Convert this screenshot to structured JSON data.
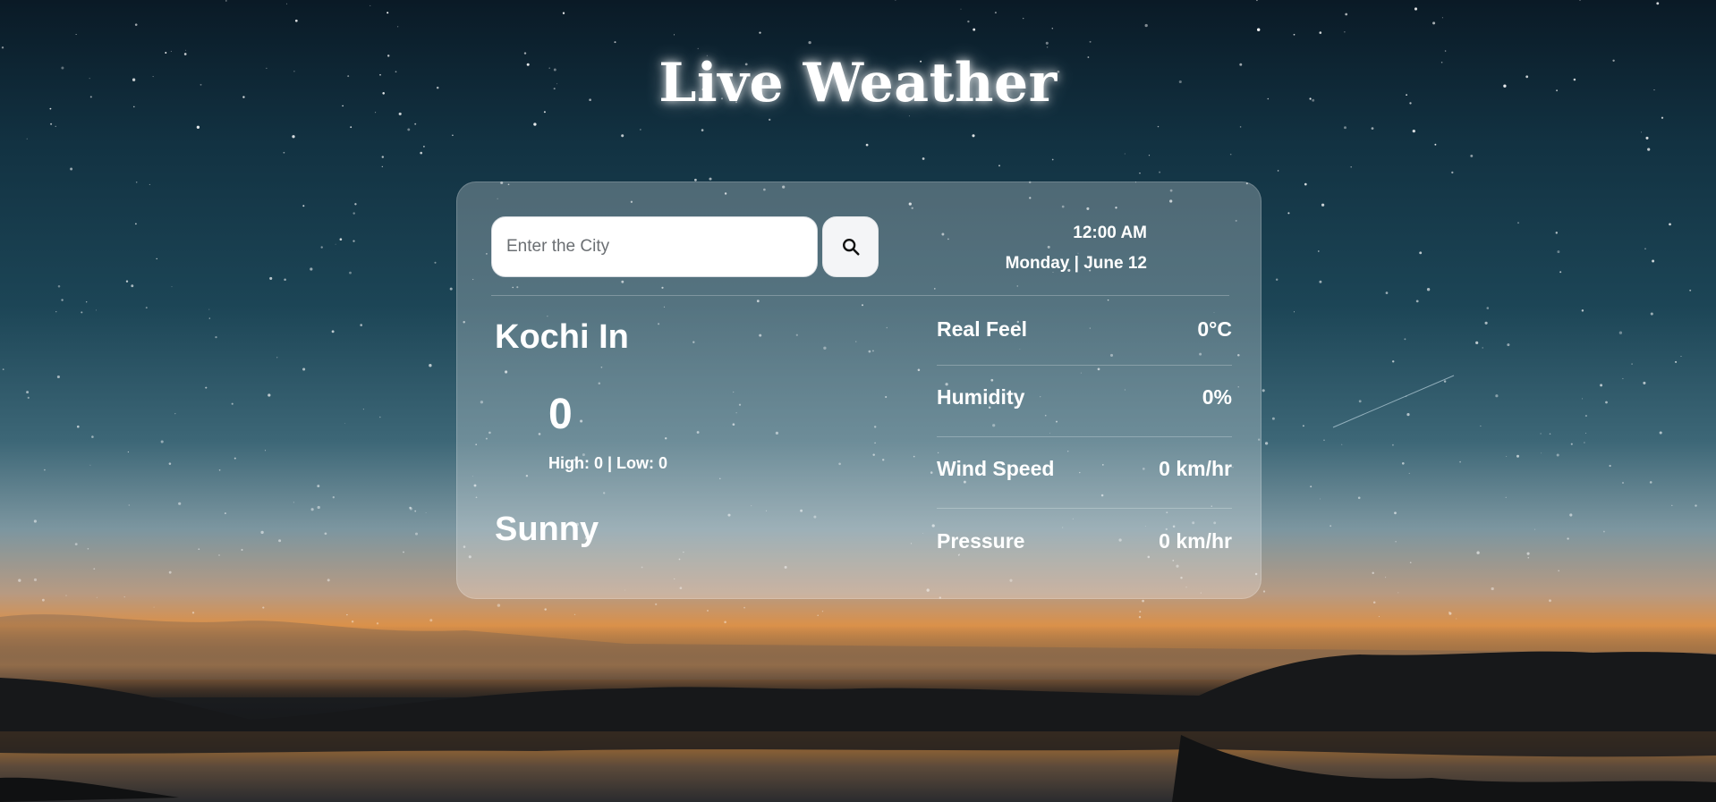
{
  "app": {
    "title": "Live Weather"
  },
  "search": {
    "placeholder": "Enter the City",
    "value": ""
  },
  "datetime": {
    "time": "12:00 AM",
    "date": "Monday | June 12"
  },
  "weather": {
    "city": "Kochi In",
    "temperature": "0",
    "high_low": "High: 0 | Low: 0",
    "condition": "Sunny"
  },
  "stats": [
    {
      "label": "Real Feel",
      "value": "0°C"
    },
    {
      "label": "Humidity",
      "value": "0%"
    },
    {
      "label": "Wind Speed",
      "value": "0 km/hr"
    },
    {
      "label": "Pressure",
      "value": "0 km/hr"
    }
  ],
  "icons": {
    "search_button": "search-icon"
  },
  "colors": {
    "card": "#ffffff40",
    "text": "#ffffff",
    "sky": "#1c4556",
    "horizon": "#d9904a"
  }
}
